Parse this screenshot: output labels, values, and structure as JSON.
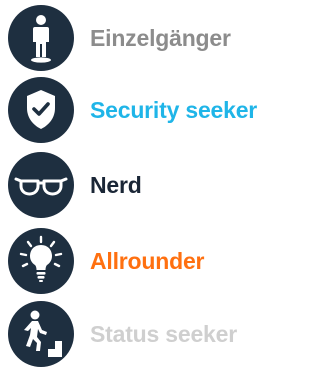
{
  "personas": [
    {
      "label": "Einzelgänger",
      "icon": "standing-person-icon",
      "color": "#8c8c8c"
    },
    {
      "label": "Security seeker",
      "icon": "shield-check-icon",
      "color": "#1fb5e8"
    },
    {
      "label": "Nerd",
      "icon": "glasses-icon",
      "color": "#1a2636"
    },
    {
      "label": "Allrounder",
      "icon": "lightbulb-icon",
      "color": "#ff7010"
    },
    {
      "label": "Status seeker",
      "icon": "stairs-climber-icon",
      "color": "#cfcfcf"
    }
  ],
  "icon_background": "#1e2f40",
  "icon_foreground": "#ffffff"
}
